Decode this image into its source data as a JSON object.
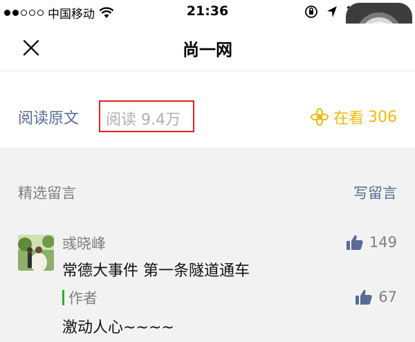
{
  "status_bar": {
    "carrier": "中国移动",
    "time": "21:36",
    "battery_partial": "2"
  },
  "nav": {
    "title": "尚一网"
  },
  "article_footer": {
    "read_original": "阅读原文",
    "read_count": "阅读 9.4万",
    "wow_label": "在看",
    "wow_count": "306"
  },
  "comments": {
    "section_title": "精选留言",
    "write_comment": "写留言",
    "items": [
      {
        "name": "彧晓峰",
        "text": "常德大事件 第一条隧道通车",
        "likes": "149",
        "reply": {
          "author": "作者",
          "text": "激动人心~~~~",
          "likes": "67"
        }
      }
    ]
  },
  "colors": {
    "link_blue": "#576b95",
    "wow_yellow": "#f0b90b",
    "highlight_red": "#e02020",
    "author_green": "#2faa33"
  }
}
